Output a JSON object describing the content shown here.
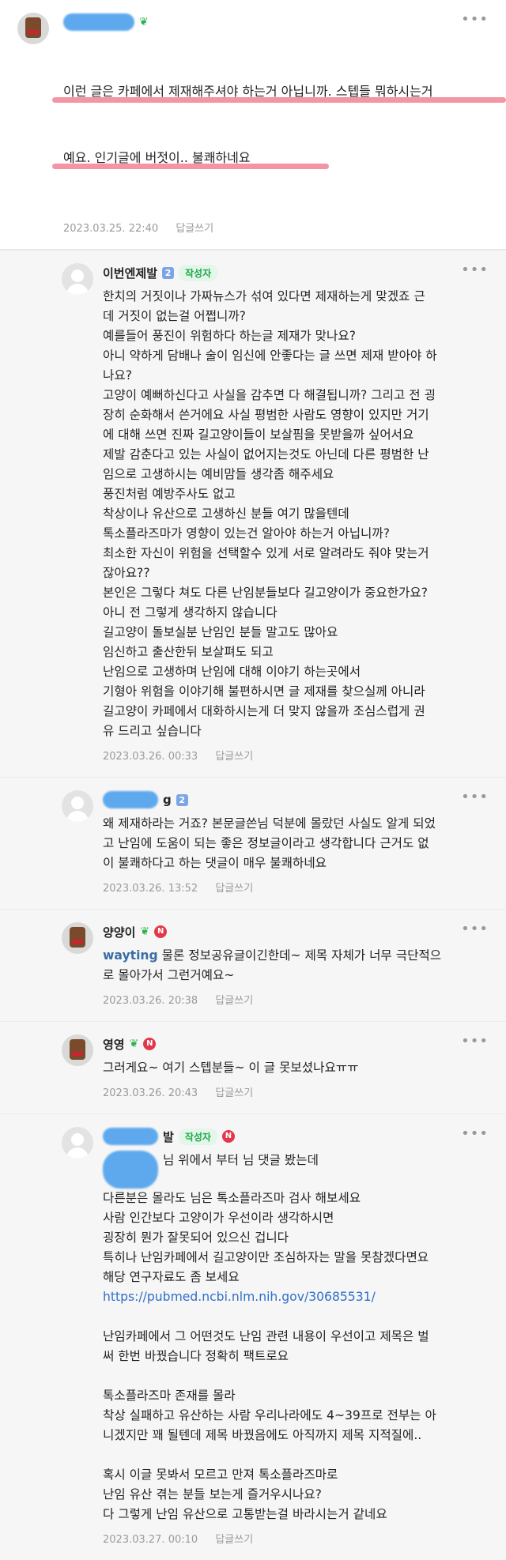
{
  "top_comment": {
    "lines": [
      "이런 글은 카페에서 제재해주셔야 하는거 아닙니까. 스텝들 뭐하시는거",
      "예요. 인기글에 버젓이.. 불쾌하네요"
    ],
    "date": "2023.03.25. 22:40",
    "reply_label": "답글쓰기",
    "more": "•••"
  },
  "comments": [
    {
      "nick": "이번엔제발",
      "level": "2",
      "author_badge": "작성자",
      "text": "한치의 거짓이나 가짜뉴스가 섞여 있다면 제재하는게 맞겠죠 근\n데 거짓이 없는걸 어쩝니까?\n예를들어 풍진이 위험하다 하는글 제재가 맞나요?\n아니 약하게 담배나 술이 임신에 안좋다는 글 쓰면 제재 받아야 하\n나요?\n고양이 예뻐하신다고 사실을 감추면 다 해결됩니까? 그리고 전 굉\n장히 순화해서 쓴거에요 사실 평범한 사람도 영향이 있지만 거기\n에 대해 쓰면 진짜 길고양이들이 보살핌을 못받을까 싶어서요\n제발 감춘다고 있는 사실이 없어지는것도 아닌데 다른 평범한 난\n임으로 고생하시는 예비맘들 생각좀 해주세요\n풍진처럼 예방주사도 없고\n착상이나 유산으로 고생하신 분들 여기 많을텐데\n톡소플라즈마가 영향이 있는건 알아야 하는거 아닙니까?\n최소한 자신이 위험을 선택할수 있게 서로 알려라도 줘야 맞는거\n잖아요??\n본인은 그렇다 쳐도 다른 난임분들보다 길고양이가 중요한가요?\n아니 전 그렇게 생각하지 않습니다\n길고양이 돌보실분 난임인 분들 말고도 많아요\n임신하고 출산한뒤 보살펴도 되고\n난임으로 고생하며 난임에 대해 이야기 하는곳에서\n기형아 위험을 이야기해 불편하시면 글 제재를 찾으실께 아니라\n길고양이 카페에서 대화하시는게 더 맞지 않을까 조심스럽게 권\n유 드리고 싶습니다",
      "date": "2023.03.26. 00:33",
      "reply_label": "답글쓰기",
      "more": "•••"
    },
    {
      "nick_suffix": "g",
      "level": "2",
      "text": "왜 제재하라는 거죠? 본문글쓴님 덕분에 몰랐던 사실도 알게 되었\n고 난임에 도움이 되는 좋은 정보글이라고 생각합니다 근거도 없\n이 불쾌하다고 하는 댓글이 매우 불쾌하네요",
      "date": "2023.03.26. 13:52",
      "reply_label": "답글쓰기",
      "more": "•••"
    },
    {
      "nick": "양양이",
      "mention": "wayting",
      "text": "물론 정보공유글이긴한데~ 제목 자체가 너무 극단적으\n로 몰아가서 그런거예요~",
      "date": "2023.03.26. 20:38",
      "reply_label": "답글쓰기",
      "more": "•••",
      "n_badge": "N"
    },
    {
      "nick": "영영",
      "text": "그러게요~ 여기 스텝분들~ 이 글 못보셨나요ㅠㅠ",
      "date": "2023.03.26. 20:43",
      "reply_label": "답글쓰기",
      "more": "•••",
      "n_badge": "N"
    },
    {
      "nick_suffix": "발",
      "author_badge": "작성자",
      "n_badge": "N",
      "first_line": "님 위에서 부터 님 댓글 봤는데",
      "text": "다른분은 몰라도 님은 톡소플라즈마 검사 해보세요\n사람 인간보다 고양이가 우선이라 생각하시면\n굉장히 뭔가 잘못되어 있으신 겁니다\n특히나 난임카페에서 길고양이만 조심하자는 말을 못참겠다면요\n해당 연구자료도 좀 보세요",
      "link": "https://pubmed.ncbi.nlm.nih.gov/30685531/",
      "text2": "난임카페에서 그 어떤것도 난임 관련 내용이 우선이고 제목은 벌\n써 한번 바꿨습니다 정확히 팩트로요",
      "text3": "톡소플라즈마 존재를 몰라\n착상 실패하고 유산하는 사람 우리나라에도 4~39프로 전부는 아\n니겠지만 꽤 될텐데 제목 바꿨음에도 아직까지 제목 지적질에..",
      "text4": "혹시 이글 못봐서 모르고 만져 톡소플라즈마로\n난임 유산 겪는 분들 보는게 즐거우시나요?\n다 그렇게 난임 유산으로 고통받는걸 바라시는거 같네요",
      "date": "2023.03.27. 00:10",
      "reply_label": "답글쓰기",
      "more": "•••"
    }
  ]
}
